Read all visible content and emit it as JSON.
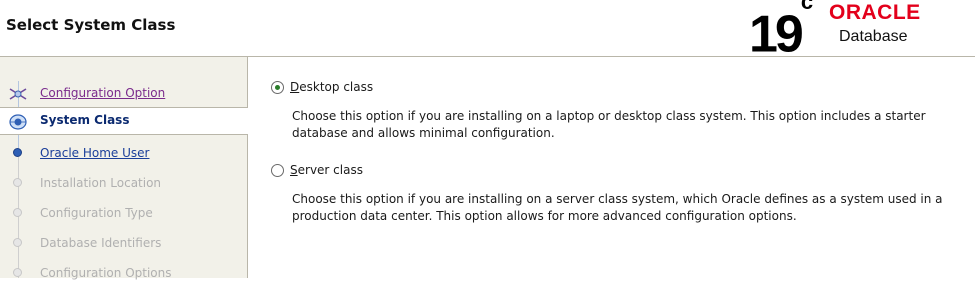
{
  "header": {
    "title": "Select System Class",
    "brand": {
      "version": "19",
      "version_suffix": "c",
      "vendor": "ORACLE",
      "product": "Database",
      "vendor_color": "#e3001b"
    }
  },
  "sidebar": {
    "steps": [
      {
        "label": "Configuration Option",
        "state": "visited",
        "icon": "tools-icon"
      },
      {
        "label": "System Class",
        "state": "current",
        "icon": "current-step-icon"
      },
      {
        "label": "Oracle Home User",
        "state": "link",
        "icon": "step-node-icon"
      },
      {
        "label": "Installation Location",
        "state": "disabled",
        "icon": "step-node-icon"
      },
      {
        "label": "Configuration Type",
        "state": "disabled",
        "icon": "step-node-icon"
      },
      {
        "label": "Database Identifiers",
        "state": "disabled",
        "icon": "step-node-icon"
      },
      {
        "label": "Configuration Options",
        "state": "disabled",
        "icon": "step-node-icon"
      }
    ]
  },
  "main": {
    "options": [
      {
        "mnemonic": "D",
        "label_rest": "esktop class",
        "selected": true,
        "description": "Choose this option if you are installing on a laptop or desktop class system. This option includes a starter database and allows minimal configuration."
      },
      {
        "mnemonic": "S",
        "label_rest": "erver class",
        "selected": false,
        "description": "Choose this option if you are installing on a server class system, which Oracle defines as a system used in a production data center. This option allows for more advanced configuration options."
      }
    ]
  }
}
